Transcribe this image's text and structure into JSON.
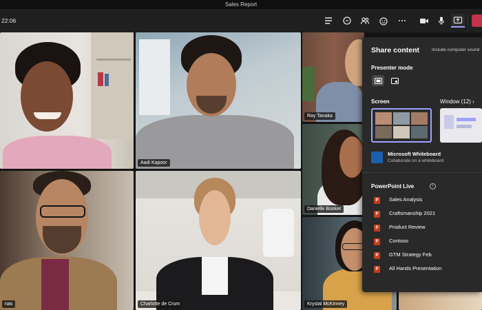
{
  "window": {
    "title": "Sales Report"
  },
  "meeting": {
    "timer": "22:06"
  },
  "toolbar": {
    "icons": [
      "list-icon",
      "chat-icon",
      "people-icon",
      "reactions-icon",
      "more-icon",
      "camera-icon",
      "mic-icon",
      "share-icon",
      "leave-icon"
    ]
  },
  "participants": [
    {
      "name": ""
    },
    {
      "name": "Aadi Kapoor"
    },
    {
      "name": "Ray Tanaka"
    },
    {
      "name": "Danielle Booker"
    },
    {
      "name": "nas"
    },
    {
      "name": "Charlotte de Crum"
    },
    {
      "name": "Krystal McKinney"
    }
  ],
  "share_panel": {
    "title": "Share content",
    "computer_sound_label": "Include computer sound",
    "presenter_mode_label": "Presenter mode",
    "screen_label": "Screen",
    "window_label": "Window (12)",
    "whiteboard": {
      "title": "Microsoft Whiteboard",
      "subtitle": "Collaborate on a whiteboard"
    },
    "powerpoint_label": "PowerPoint Live",
    "ppt_icon_letter": "P",
    "info_glyph": "i",
    "files": [
      "Sales Analysis",
      "Craftsmanship 2021",
      "Product Review",
      "Contoso",
      "GTM Strategy Feb",
      "All Hands Presentation"
    ]
  },
  "colors": {
    "accent": "#9ea2ff",
    "leave": "#c4314b",
    "panel": "#292929",
    "ppt": "#c43e1c",
    "whiteboard": "#1b5fb0"
  }
}
